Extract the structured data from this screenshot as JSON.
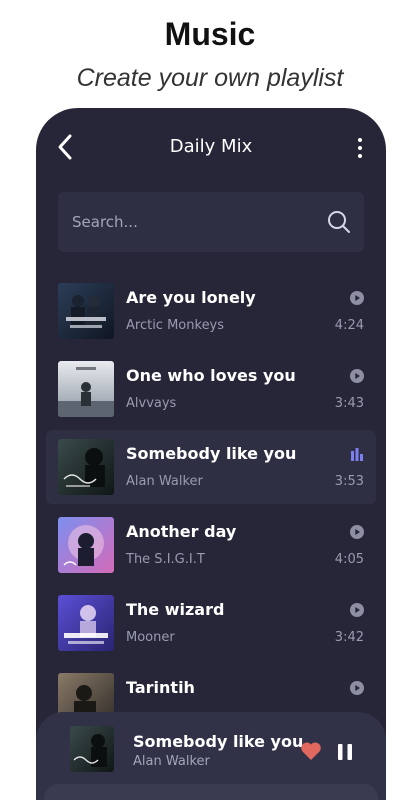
{
  "promo": {
    "title": "Music",
    "subtitle": "Create your own playlist"
  },
  "header": {
    "title": "Daily Mix",
    "back_icon": "chevron-left-icon",
    "more_icon": "more-vertical-icon"
  },
  "search": {
    "placeholder": "Search...",
    "icon": "search-icon"
  },
  "tracks": [
    {
      "title": "Are you lonely",
      "artist": "Arctic Monkeys",
      "duration": "4:24",
      "status_icon": "play-icon",
      "active": false
    },
    {
      "title": "One who loves you",
      "artist": "Alvvays",
      "duration": "3:43",
      "status_icon": "play-icon",
      "active": false
    },
    {
      "title": "Somebody like you",
      "artist": "Alan Walker",
      "duration": "3:53",
      "status_icon": "equalizer-icon",
      "active": true
    },
    {
      "title": "Another day",
      "artist": "The S.I.G.I.T",
      "duration": "4:05",
      "status_icon": "play-icon",
      "active": false
    },
    {
      "title": "The wizard",
      "artist": "Mooner",
      "duration": "3:42",
      "status_icon": "play-icon",
      "active": false
    },
    {
      "title": "Tarintih",
      "artist": "",
      "duration": "",
      "status_icon": "play-icon",
      "active": false
    }
  ],
  "now_playing": {
    "title": "Somebody like you",
    "artist": "Alan Walker",
    "heart_icon": "heart-icon",
    "pause_icon": "pause-icon"
  },
  "colors": {
    "background": "#262638",
    "active_row": "#2f2f44",
    "accent_equalizer": "#7b7ff0",
    "heart": "#e0685f",
    "text_primary": "#ffffff",
    "text_secondary": "#9a9bb0"
  }
}
